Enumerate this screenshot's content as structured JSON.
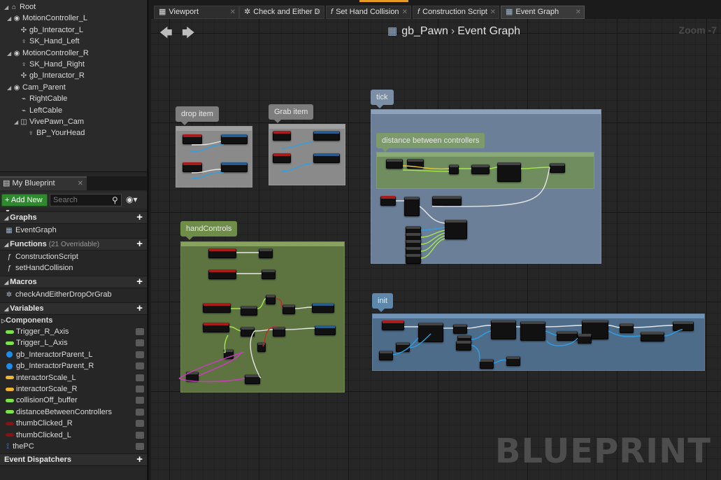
{
  "components": {
    "tree": [
      {
        "label": "Root",
        "icon": "root-icon",
        "glyph": "⌂"
      },
      {
        "label": "MotionController_L",
        "icon": "motion-controller-icon",
        "glyph": "◉"
      },
      {
        "label": "gb_Interactor_L",
        "icon": "sphere-component-icon",
        "glyph": "✣"
      },
      {
        "label": "SK_Hand_Left",
        "icon": "skeletal-mesh-icon",
        "glyph": "♀"
      },
      {
        "label": "MotionController_R",
        "icon": "motion-controller-icon",
        "glyph": "◉"
      },
      {
        "label": "SK_Hand_Right",
        "icon": "skeletal-mesh-icon",
        "glyph": "♀"
      },
      {
        "label": "gb_Interactor_R",
        "icon": "sphere-component-icon",
        "glyph": "✣"
      },
      {
        "label": "Cam_Parent",
        "icon": "scene-component-icon",
        "glyph": "◉"
      },
      {
        "label": "RightCable",
        "icon": "cable-icon",
        "glyph": "⌁"
      },
      {
        "label": "LeftCable",
        "icon": "cable-icon",
        "glyph": "⌁"
      },
      {
        "label": "VivePawn_Cam",
        "icon": "camera-icon",
        "glyph": "◫"
      },
      {
        "label": "BP_YourHead",
        "icon": "actor-icon",
        "glyph": "♀"
      }
    ]
  },
  "my_blueprint": {
    "tab_label": "My Blueprint",
    "add_new_label": "Add New",
    "search_placeholder": "Search",
    "sections": {
      "graphs": "Graphs",
      "functions": "Functions",
      "functions_note": "(21 Overridable)",
      "macros": "Macros",
      "variables": "Variables",
      "components": "Components",
      "event_dispatchers": "Event Dispatchers"
    },
    "graphs": [
      "EventGraph"
    ],
    "functions": [
      "ConstructionScript",
      "setHandCollision"
    ],
    "macros": [
      "checkAndEitherDropOrGrab"
    ],
    "variables": [
      {
        "name": "Trigger_R_Axis",
        "color": "#7ee24a",
        "shape": "pill"
      },
      {
        "name": "Trigger_L_Axis",
        "color": "#7ee24a",
        "shape": "pill"
      },
      {
        "name": "gb_InteractorParent_L",
        "color": "#1a8ef0",
        "shape": "dot"
      },
      {
        "name": "gb_InteractorParent_R",
        "color": "#1a8ef0",
        "shape": "dot"
      },
      {
        "name": "interactorScale_L",
        "color": "#f0b430",
        "shape": "pill"
      },
      {
        "name": "interactorScale_R",
        "color": "#f0b430",
        "shape": "pill"
      },
      {
        "name": "collisionOff_buffer",
        "color": "#7ee24a",
        "shape": "pill"
      },
      {
        "name": "distanceBetweenControllers",
        "color": "#7ee24a",
        "shape": "pill"
      },
      {
        "name": "thumbClicked_R",
        "color": "#8c1010",
        "shape": "pill"
      },
      {
        "name": "thumbClicked_L",
        "color": "#8c1010",
        "shape": "pill"
      },
      {
        "name": "thePC",
        "color": "#3c8cf0",
        "shape": "icon"
      }
    ]
  },
  "tabs": [
    {
      "label": "Viewport",
      "icon": "viewport-icon",
      "glyph": "▦"
    },
    {
      "label": "Check and Either D",
      "icon": "macro-icon",
      "glyph": "✲"
    },
    {
      "label": "Set Hand Collision",
      "icon": "function-icon",
      "glyph": "f"
    },
    {
      "label": "Construction Script",
      "icon": "function-icon",
      "glyph": "f"
    },
    {
      "label": "Event Graph",
      "icon": "graph-icon",
      "glyph": "▦"
    }
  ],
  "graph": {
    "blueprint_name": "gb_Pawn",
    "graph_name": "Event Graph",
    "zoom": "Zoom -7",
    "watermark": "BLUEPRINT",
    "comments": {
      "drop_item": "drop item",
      "grab_item": "Grab item",
      "tick": "tick",
      "distance": "distance between controllers",
      "hand_controls": "handControls",
      "init": "init"
    }
  },
  "colors": {
    "pin_exec": "#e6e6e6",
    "pin_float": "#a6e84a",
    "pin_object": "#2ea0e6",
    "pin_bool": "#c0282c",
    "pin_vector": "#f0c832",
    "pin_struct": "#d238c8"
  }
}
